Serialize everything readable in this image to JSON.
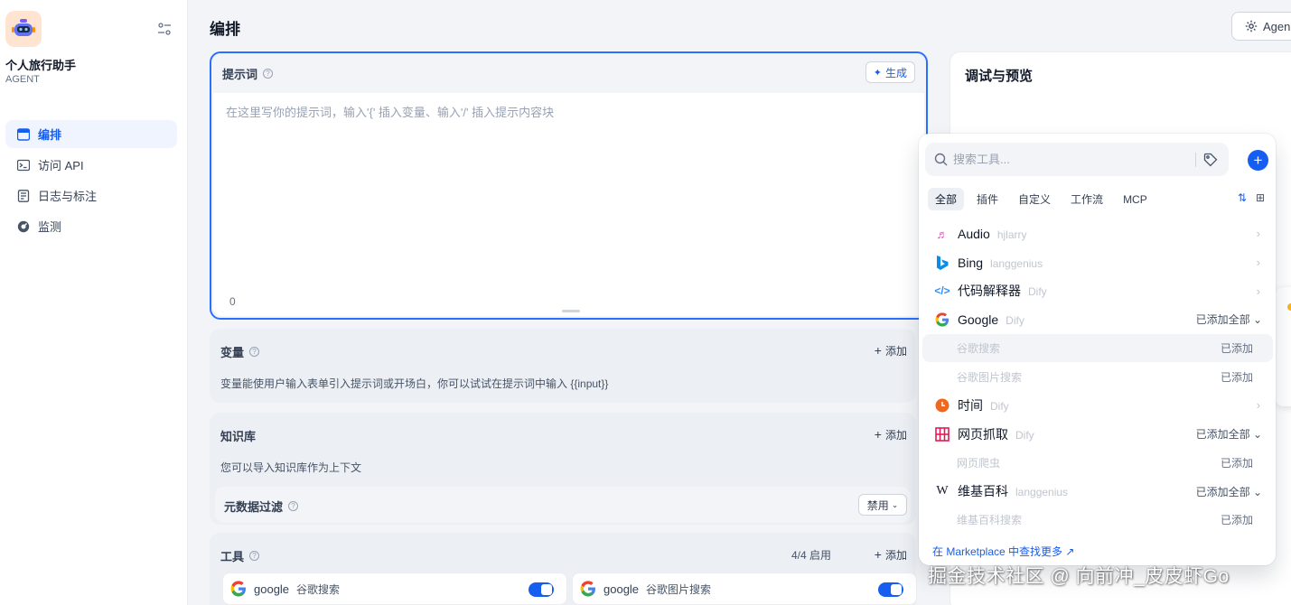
{
  "app": {
    "name": "个人旅行助手",
    "type": "AGENT"
  },
  "nav": [
    {
      "label": "编排",
      "icon": "layout-icon",
      "active": true
    },
    {
      "label": "访问 API",
      "icon": "terminal-icon",
      "active": false
    },
    {
      "label": "日志与标注",
      "icon": "document-icon",
      "active": false
    },
    {
      "label": "监测",
      "icon": "gauge-icon",
      "active": false
    }
  ],
  "header": {
    "title": "编排",
    "agent_button": "Agen"
  },
  "prompt": {
    "title": "提示词",
    "generate": "生成",
    "placeholder": "在这里写你的提示词，输入'{' 插入变量、输入'/' 插入提示内容块",
    "count": "0"
  },
  "variables": {
    "title": "变量",
    "add": "添加",
    "desc": "变量能使用户输入表单引入提示词或开场白，你可以试试在提示词中输入 {{input}}"
  },
  "knowledge": {
    "title": "知识库",
    "add": "添加",
    "desc": "您可以导入知识库作为上下文",
    "filter_label": "元数据过滤",
    "filter_value": "禁用"
  },
  "tools": {
    "title": "工具",
    "count": "4/4 启用",
    "add": "添加",
    "items": [
      {
        "provider": "google",
        "name": "谷歌搜索",
        "enabled": true
      },
      {
        "provider": "google",
        "name": "谷歌图片搜索",
        "enabled": true
      }
    ]
  },
  "debug": {
    "title": "调试与预览"
  },
  "picker": {
    "search_placeholder": "搜索工具...",
    "tabs": [
      "全部",
      "插件",
      "自定义",
      "工作流",
      "MCP"
    ],
    "active_tab": "全部",
    "providers": [
      {
        "name": "Audio",
        "author": "hjlarry",
        "icon": "audio-icon",
        "status": "",
        "expanded": false
      },
      {
        "name": "Bing",
        "author": "langgenius",
        "icon": "bing-icon",
        "status": "",
        "expanded": false
      },
      {
        "name": "代码解释器",
        "author": "Dify",
        "icon": "code-icon",
        "status": "",
        "expanded": false
      },
      {
        "name": "Google",
        "author": "Dify",
        "icon": "google-icon",
        "status": "已添加全部",
        "expanded": true,
        "tools": [
          {
            "name": "谷歌搜索",
            "status": "已添加"
          },
          {
            "name": "谷歌图片搜索",
            "status": "已添加"
          }
        ]
      },
      {
        "name": "时间",
        "author": "Dify",
        "icon": "clock-icon",
        "status": "",
        "expanded": false
      },
      {
        "name": "网页抓取",
        "author": "Dify",
        "icon": "webscraper-icon",
        "status": "已添加全部",
        "expanded": true,
        "tools": [
          {
            "name": "网页爬虫",
            "status": "已添加"
          }
        ]
      },
      {
        "name": "维基百科",
        "author": "langgenius",
        "icon": "wikipedia-icon",
        "status": "已添加全部",
        "expanded": true,
        "tools": [
          {
            "name": "维基百科搜索",
            "status": "已添加"
          }
        ]
      }
    ],
    "marketplace_link": "在 Marketplace 中查找更多 ↗"
  },
  "watermark": "掘金技术社区 @ 向前冲_皮皮虾Go",
  "colors": {
    "accent": "#155eef",
    "focus_border": "#2970ff"
  }
}
